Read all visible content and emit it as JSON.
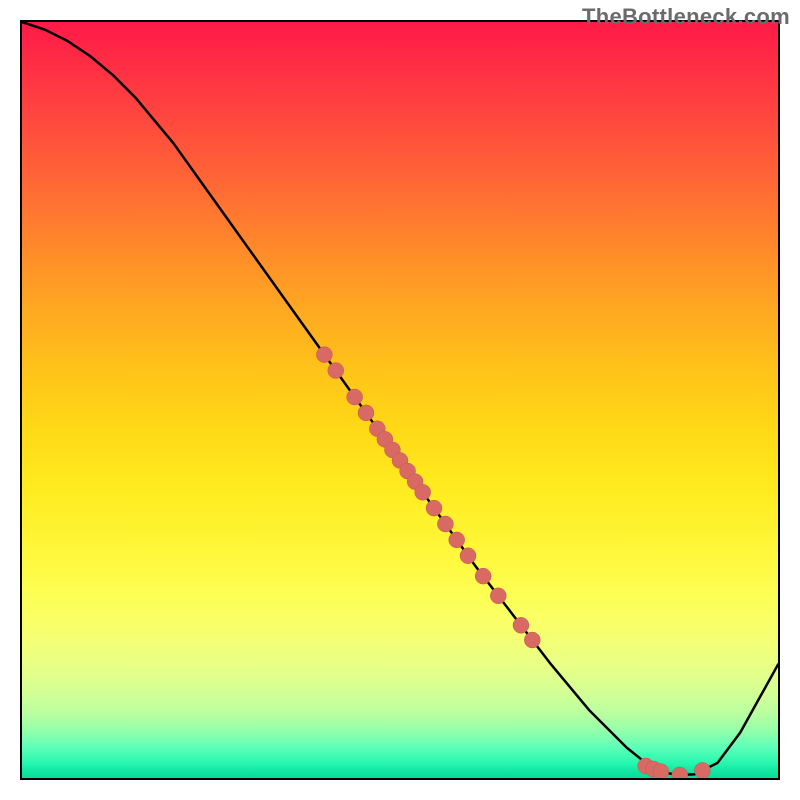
{
  "watermark": "TheBottleneck.com",
  "chart_data": {
    "type": "line",
    "title": "",
    "xlabel": "",
    "ylabel": "",
    "xlim": [
      0,
      100
    ],
    "ylim": [
      0,
      100
    ],
    "description": "Bottleneck severity curve over an unlabeled x-axis. Background is a vertical severity gradient from red (high/bad) to green (low/good). A single black curve starts near the top-left, descends roughly linearly to a minimum near x≈85, then rises toward the right edge. Salmon-colored dots mark sampled points along the descending limb and around the minimum.",
    "series": [
      {
        "name": "bottleneck-curve",
        "x": [
          0,
          3,
          6,
          9,
          12,
          15,
          20,
          25,
          30,
          35,
          40,
          45,
          50,
          55,
          60,
          65,
          70,
          75,
          80,
          83,
          85,
          87,
          89,
          92,
          95,
          100
        ],
        "y": [
          100,
          99,
          97.5,
          95.5,
          93,
          90,
          84,
          77,
          70,
          63,
          56,
          49,
          42,
          35,
          28,
          21.5,
          15,
          9,
          4,
          1.6,
          0.7,
          0.4,
          0.5,
          2,
          6,
          15
        ]
      }
    ],
    "markers": [
      {
        "x": 40,
        "y": 56
      },
      {
        "x": 41.5,
        "y": 53.9
      },
      {
        "x": 44,
        "y": 50.4
      },
      {
        "x": 45.5,
        "y": 48.3
      },
      {
        "x": 47,
        "y": 46.2
      },
      {
        "x": 48,
        "y": 44.8
      },
      {
        "x": 49,
        "y": 43.4
      },
      {
        "x": 50,
        "y": 42
      },
      {
        "x": 51,
        "y": 40.6
      },
      {
        "x": 52,
        "y": 39.2
      },
      {
        "x": 53,
        "y": 37.8
      },
      {
        "x": 54.5,
        "y": 35.7
      },
      {
        "x": 56,
        "y": 33.6
      },
      {
        "x": 57.5,
        "y": 31.5
      },
      {
        "x": 59,
        "y": 29.4
      },
      {
        "x": 61,
        "y": 26.7
      },
      {
        "x": 63,
        "y": 24.1
      },
      {
        "x": 66,
        "y": 20.2
      },
      {
        "x": 67.5,
        "y": 18.25
      },
      {
        "x": 82.5,
        "y": 1.6
      },
      {
        "x": 83.5,
        "y": 1.2
      },
      {
        "x": 84.5,
        "y": 0.85
      },
      {
        "x": 87,
        "y": 0.4
      },
      {
        "x": 90,
        "y": 1
      }
    ],
    "marker_radius_px": 8,
    "colors": {
      "curve": "#000000",
      "marker": "#d86a63",
      "gradient_top": "#ff1a48",
      "gradient_bottom": "#0ad996"
    }
  }
}
